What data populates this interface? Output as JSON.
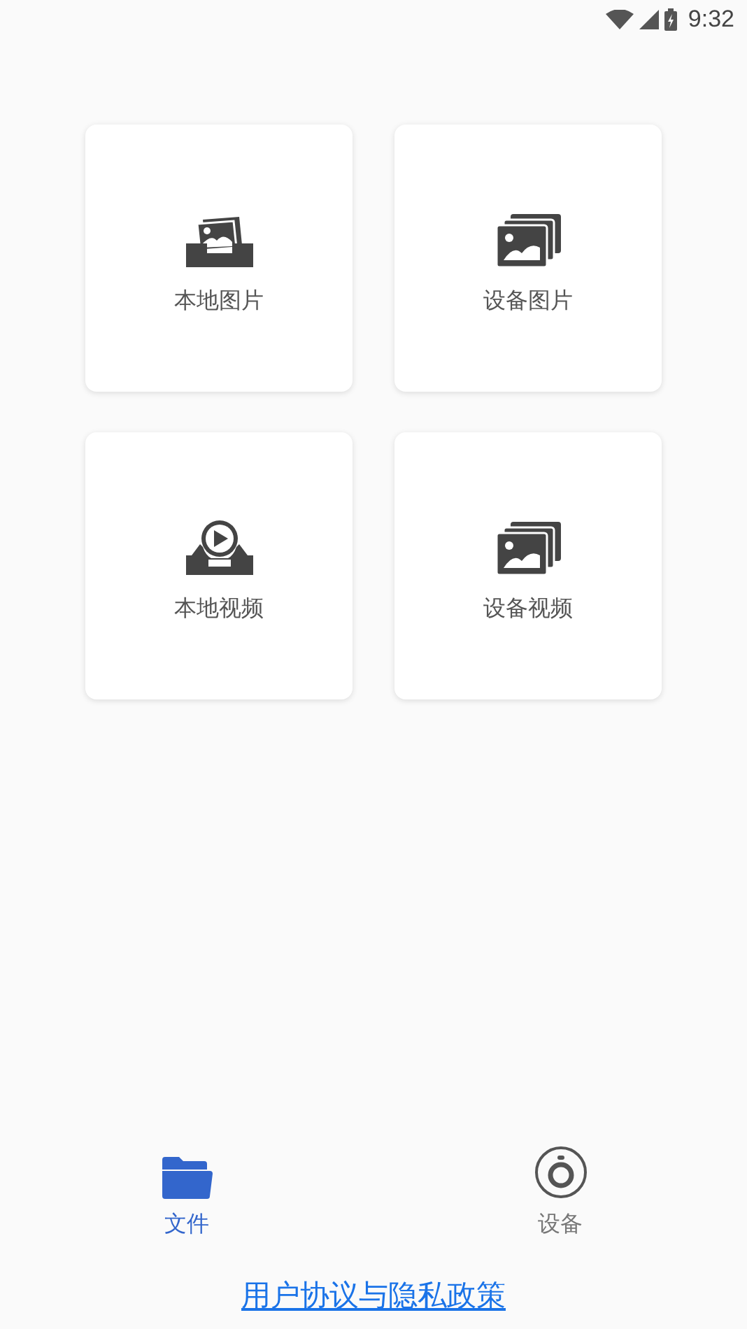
{
  "status_bar": {
    "time": "9:32"
  },
  "cards": [
    {
      "label": "本地图片",
      "kind": "local-image"
    },
    {
      "label": "设备图片",
      "kind": "device-image"
    },
    {
      "label": "本地视频",
      "kind": "local-video"
    },
    {
      "label": "设备视频",
      "kind": "device-video"
    }
  ],
  "tabs": [
    {
      "label": "文件",
      "kind": "folder",
      "selected": true
    },
    {
      "label": "设备",
      "kind": "device",
      "selected": false
    }
  ],
  "footer_link": "用户协议与隐私政策"
}
